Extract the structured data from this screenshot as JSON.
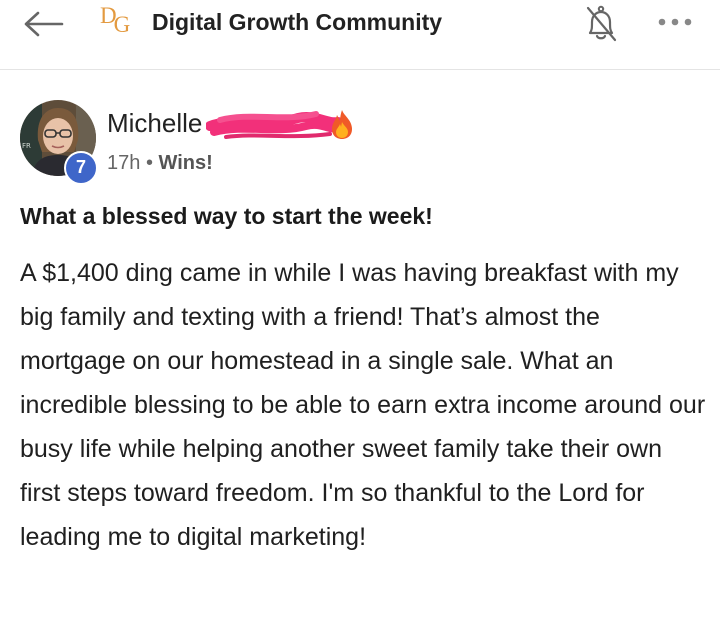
{
  "header": {
    "logo_text": "DG",
    "community_name": "Digital Growth Community",
    "back_icon": "arrow-left-icon",
    "bell_icon": "bell-off-icon",
    "more_icon": "more-horizontal-icon"
  },
  "post": {
    "author_name": "Michelle",
    "level": "7",
    "time": "17h",
    "separator": "•",
    "category": "Wins!",
    "title": "What a blessed way to start the week!",
    "body": "A $1,400 ding came in while I was having breakfast with my big family and texting with a friend! That’s almost the mortgage on our homestead in a single sale. What an incredible blessing to be able to earn extra income around our busy life while helping another sweet family take their own first steps toward freedom. I'm so thankful to the Lord for leading me to digital marketing!"
  },
  "colors": {
    "accent_logo": "#e39a40",
    "level_badge": "#3f66c9",
    "redaction": "#f2307a"
  }
}
